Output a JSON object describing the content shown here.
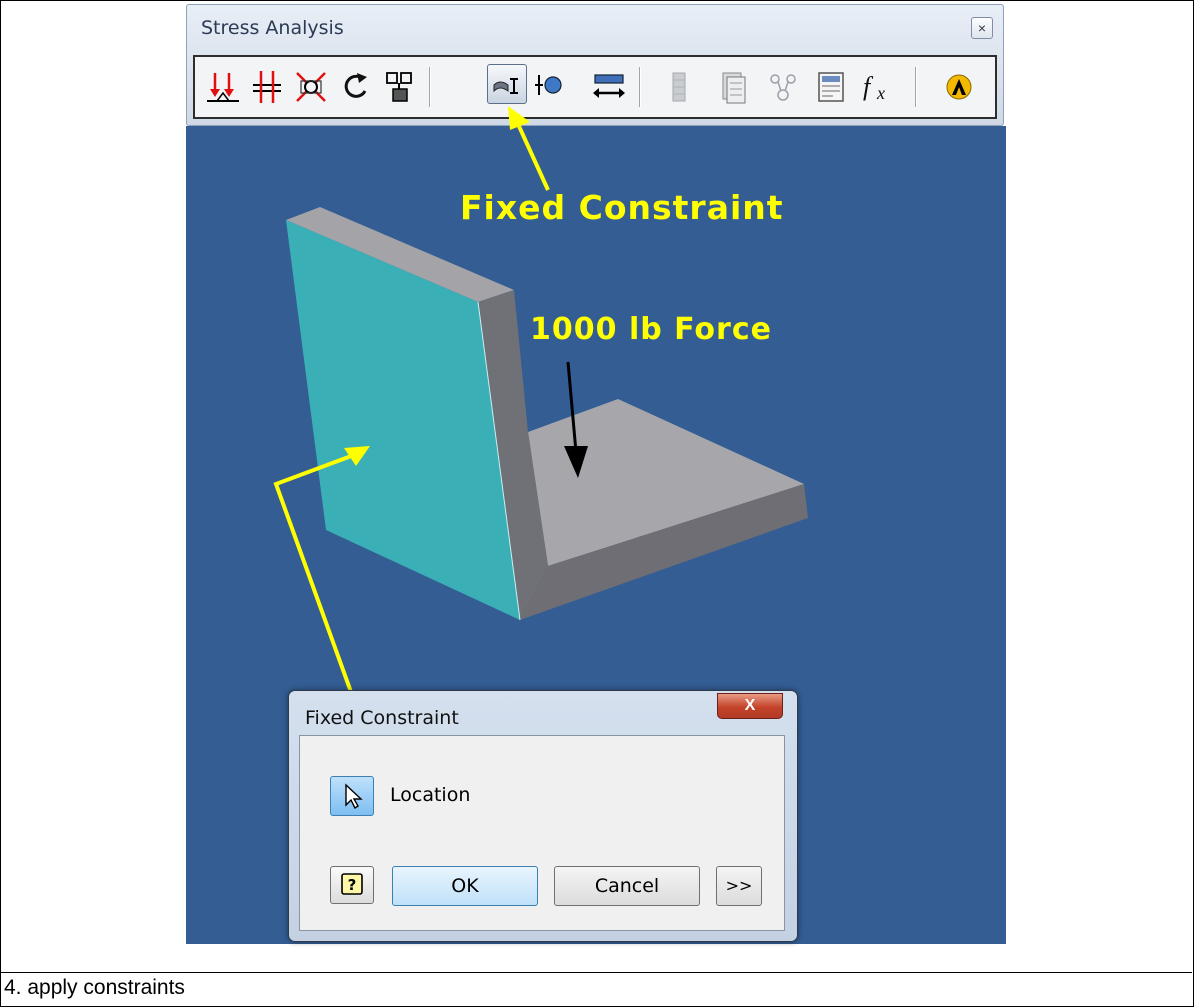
{
  "panel": {
    "title": "Stress Analysis",
    "close_glyph": "×",
    "tools": [
      {
        "name": "force-icon"
      },
      {
        "name": "pressure-icon"
      },
      {
        "name": "bearing-load-icon"
      },
      {
        "name": "moment-icon"
      },
      {
        "name": "body-load-icon"
      },
      {
        "name": "fixed-constraint-icon",
        "active": true
      },
      {
        "name": "pin-constraint-icon"
      },
      {
        "name": "frictionless-constraint-icon"
      },
      {
        "name": "mesh-settings-icon",
        "disabled": true
      },
      {
        "name": "simulation-icon"
      },
      {
        "name": "local-mesh-icon"
      },
      {
        "name": "report-icon"
      },
      {
        "name": "parameters-fx-icon"
      },
      {
        "name": "ansys-icon"
      }
    ]
  },
  "annotations": {
    "fixed_constraint": "Fixed Constraint",
    "force": "1000 lb Force"
  },
  "dialog": {
    "title": "Fixed Constraint",
    "close_glyph": "X",
    "location_label": "Location",
    "ok_label": "OK",
    "cancel_label": "Cancel",
    "more_label": ">>"
  },
  "caption": "4. apply constraints",
  "colors": {
    "viewport": "#335d93",
    "annotation": "#ffff00",
    "face_selected": "#3aafb6",
    "part_gray": "#a7a7ab"
  }
}
